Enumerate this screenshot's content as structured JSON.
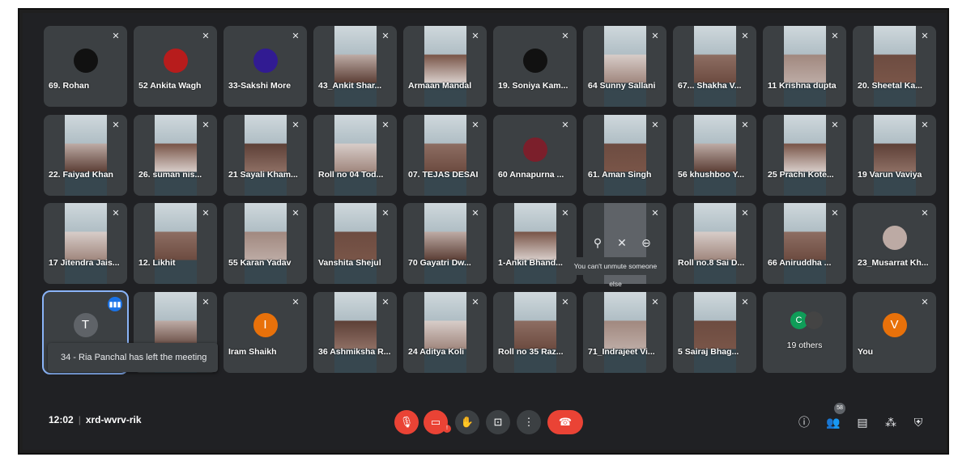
{
  "meeting": {
    "time": "12:02",
    "code": "xrd-wvrv-rik"
  },
  "participants": [
    {
      "name": "69. Rohan"
    },
    {
      "name": "52 Ankita Wagh"
    },
    {
      "name": "33-Sakshi More"
    },
    {
      "name": "43_Ankit Shar..."
    },
    {
      "name": "Armaan Mandal"
    },
    {
      "name": "19. Soniya Kam..."
    },
    {
      "name": "64 Sunny Sallani"
    },
    {
      "name": "67... Shakha V..."
    },
    {
      "name": "11 Krishna dupta"
    },
    {
      "name": "20. Sheetal Ka..."
    },
    {
      "name": "22. Faiyad Khan"
    },
    {
      "name": "26. suman nis..."
    },
    {
      "name": "21 Sayali Kham..."
    },
    {
      "name": "Roll no 04 Tod..."
    },
    {
      "name": "07. TEJAS DESAI"
    },
    {
      "name": "60 Annapurna ..."
    },
    {
      "name": "61. Aman Singh"
    },
    {
      "name": "56 khushboo Y..."
    },
    {
      "name": "25 Prachi Kote..."
    },
    {
      "name": "19 Varun Vaviya"
    },
    {
      "name": "17 Jitendra Jais..."
    },
    {
      "name": "12. Likhit"
    },
    {
      "name": "55 Karan Yadav"
    },
    {
      "name": "Vanshita Shejul"
    },
    {
      "name": "70 Gayatri Dw..."
    },
    {
      "name": "1-Ankit Bhand..."
    },
    {
      "name": ""
    },
    {
      "name": "Roll no.8 Sai D..."
    },
    {
      "name": "66 Aniruddha ..."
    },
    {
      "name": "23_Musarrat Kh..."
    },
    {
      "name": ""
    },
    {
      "name": ""
    },
    {
      "name": "Iram Shaikh"
    },
    {
      "name": "36 Ashmiksha R..."
    },
    {
      "name": "24 Aditya Koli"
    },
    {
      "name": "Roll no 35 Raz..."
    },
    {
      "name": "71_Indrajeet Vi..."
    },
    {
      "name": "5 Sairaj Bhag..."
    },
    {
      "name": "19 others"
    },
    {
      "name": "You"
    }
  ],
  "avatars": {
    "T": "T",
    "I": "I",
    "V": "V",
    "C": "C"
  },
  "toast": "34 - Ria Panchal has left the meeting",
  "tooltip": "You can't unmute someone else",
  "participant_count": "58",
  "end_call_label": "",
  "colors": {
    "bg": "#202124",
    "tile": "#3c4043",
    "red": "#ea4335",
    "orange": "#e8710a",
    "active": "#8ab4f8"
  },
  "icons": [
    "mic-off-icon",
    "camera-off-icon",
    "raise-hand-icon",
    "present-icon",
    "more-icon",
    "end-call-icon",
    "info-icon",
    "people-icon",
    "chat-icon",
    "activities-icon",
    "host-controls-icon"
  ]
}
